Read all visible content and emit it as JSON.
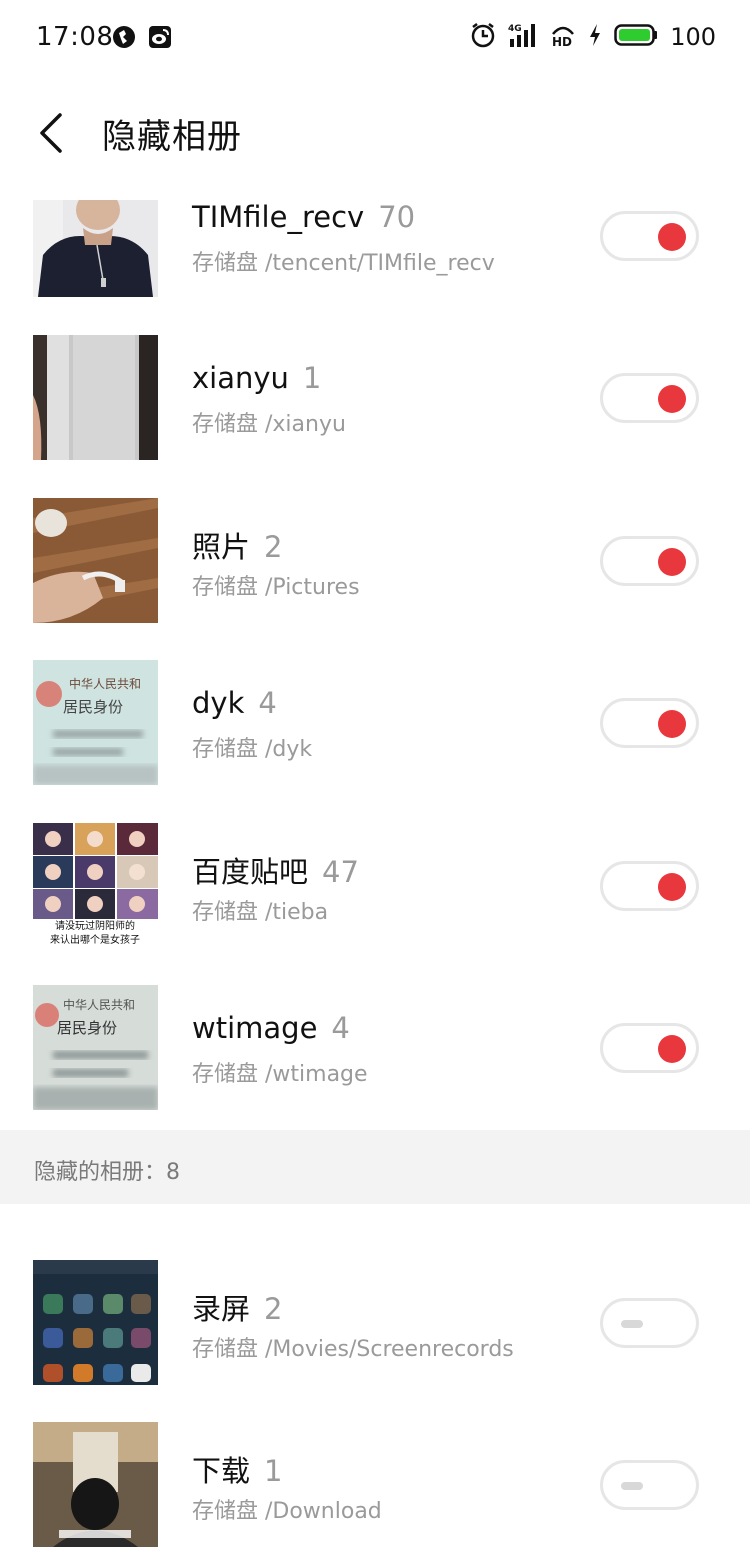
{
  "status_bar": {
    "time": "17:08",
    "battery": "100",
    "icons": [
      "clock-icon",
      "signal-4g-icon",
      "hd-icon",
      "charging-icon",
      "battery-icon"
    ],
    "left_icons": [
      "app-notification-icon",
      "weibo-icon"
    ]
  },
  "header": {
    "title": "隐藏相册",
    "back_icon": "chevron-left-icon"
  },
  "albums_visible": [
    {
      "title": "TIMfile_recv",
      "count": "70",
      "path": "存储盘 /tencent/TIMfile_recv",
      "enabled": true
    },
    {
      "title": "xianyu",
      "count": "1",
      "path": "存储盘 /xianyu",
      "enabled": true
    },
    {
      "title": "照片",
      "count": "2",
      "path": "存储盘 /Pictures",
      "enabled": true
    },
    {
      "title": "dyk",
      "count": "4",
      "path": "存储盘 /dyk",
      "enabled": true
    },
    {
      "title": "百度贴吧",
      "count": "47",
      "path": "存储盘 /tieba",
      "enabled": true
    },
    {
      "title": "wtimage",
      "count": "4",
      "path": "存储盘 /wtimage",
      "enabled": true
    }
  ],
  "hidden_section": {
    "label": "隐藏的相册：8"
  },
  "albums_hidden": [
    {
      "title": "录屏",
      "count": "2",
      "path": "存储盘 /Movies/Screenrecords",
      "enabled": false
    },
    {
      "title": "下载",
      "count": "1",
      "path": "存储盘 /Download",
      "enabled": false
    }
  ],
  "thumb_texts": {
    "id_card_line1": "中华人民共和",
    "id_card_line2": "居民身份",
    "id_card2_line1": "中华人民共和",
    "id_card2_line2": "居民身份",
    "tieba_caption1": "请没玩过阴阳师的",
    "tieba_caption2": "来认出哪个是女孩子"
  },
  "colors": {
    "toggle_on": "#e8383d",
    "toggle_border": "#e6e6e6",
    "secondary_text": "#9a9a9a",
    "section_bg": "#f3f3f3"
  }
}
